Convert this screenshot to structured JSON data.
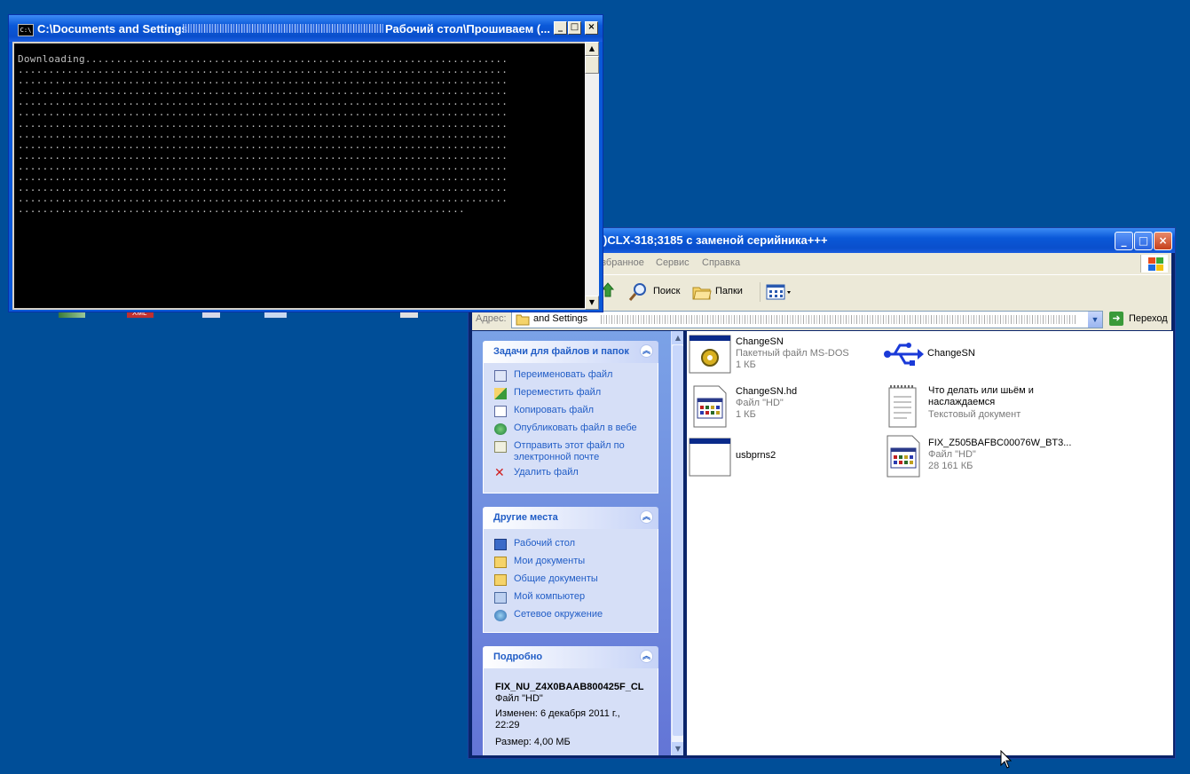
{
  "console": {
    "title_prefix": "C:\\Documents and Settings",
    "title_suffix": "Рабочий стол\\Прошиваем (...",
    "icon_text": "C:\\",
    "output_first": "Downloading.",
    "buttons": {
      "minimize": "_",
      "maximize": "□",
      "close": "×"
    }
  },
  "explorer": {
    "title": ")CLX-318;3185 с заменой серийника+++",
    "menu": [
      "збранное",
      "Сервис",
      "Справка"
    ],
    "toolbar": {
      "search": "Поиск",
      "folders": "Папки"
    },
    "address": {
      "label": "Адрес:",
      "value": "and Settings",
      "go": "Переход"
    },
    "tasks_panel": {
      "title": "Задачи для файлов и папок",
      "items": [
        {
          "label": "Переименовать файл",
          "icon": "rename-icon"
        },
        {
          "label": "Переместить файл",
          "icon": "move-icon"
        },
        {
          "label": "Копировать файл",
          "icon": "copy-icon"
        },
        {
          "label": "Опубликовать файл в вебе",
          "icon": "web-publish-icon"
        },
        {
          "label": "Отправить этот файл по электронной почте",
          "icon": "email-icon"
        },
        {
          "label": "Удалить файл",
          "icon": "delete-icon"
        }
      ]
    },
    "places_panel": {
      "title": "Другие места",
      "items": [
        {
          "label": "Рабочий стол",
          "icon": "desktop-icon"
        },
        {
          "label": "Мои документы",
          "icon": "my-documents-icon"
        },
        {
          "label": "Общие документы",
          "icon": "shared-documents-icon"
        },
        {
          "label": "Мой компьютер",
          "icon": "my-computer-icon"
        },
        {
          "label": "Сетевое окружение",
          "icon": "network-icon"
        }
      ]
    },
    "details_panel": {
      "title": "Подробно",
      "filename": "FIX_NU_Z4X0BAAB800425F_CL",
      "type": "Файл \"HD\"",
      "modified": "Изменен: 6 декабря 2011 г., 22:29",
      "size": "Размер: 4,00 МБ"
    },
    "files": [
      {
        "name": "ChangeSN",
        "type": "Пакетный файл MS-DOS",
        "size": "1 КБ",
        "icon": "batch-file-icon"
      },
      {
        "name": "ChangeSN",
        "type": "",
        "size": "",
        "icon": "usb-icon"
      },
      {
        "name": "ChangeSN.hd",
        "type": "Файл \"HD\"",
        "size": "1 КБ",
        "icon": "hd-file-icon"
      },
      {
        "name": "Что делать или шьём и наслаждаемся",
        "type": "Текстовый документ",
        "size": "",
        "icon": "text-document-icon"
      },
      {
        "name": "usbprns2",
        "type": "",
        "size": "",
        "icon": "application-icon"
      },
      {
        "name": "FIX_Z505BAFBC00076W_BT3...",
        "type": "Файл \"HD\"",
        "size": "28 161 КБ",
        "icon": "hd-file-icon"
      }
    ]
  },
  "desktop": {
    "partial_labels": [
      "XML"
    ]
  },
  "colors": {
    "desktop": "#004e98",
    "xp_blue": "#0a58d8",
    "task_link": "#215dc6"
  }
}
